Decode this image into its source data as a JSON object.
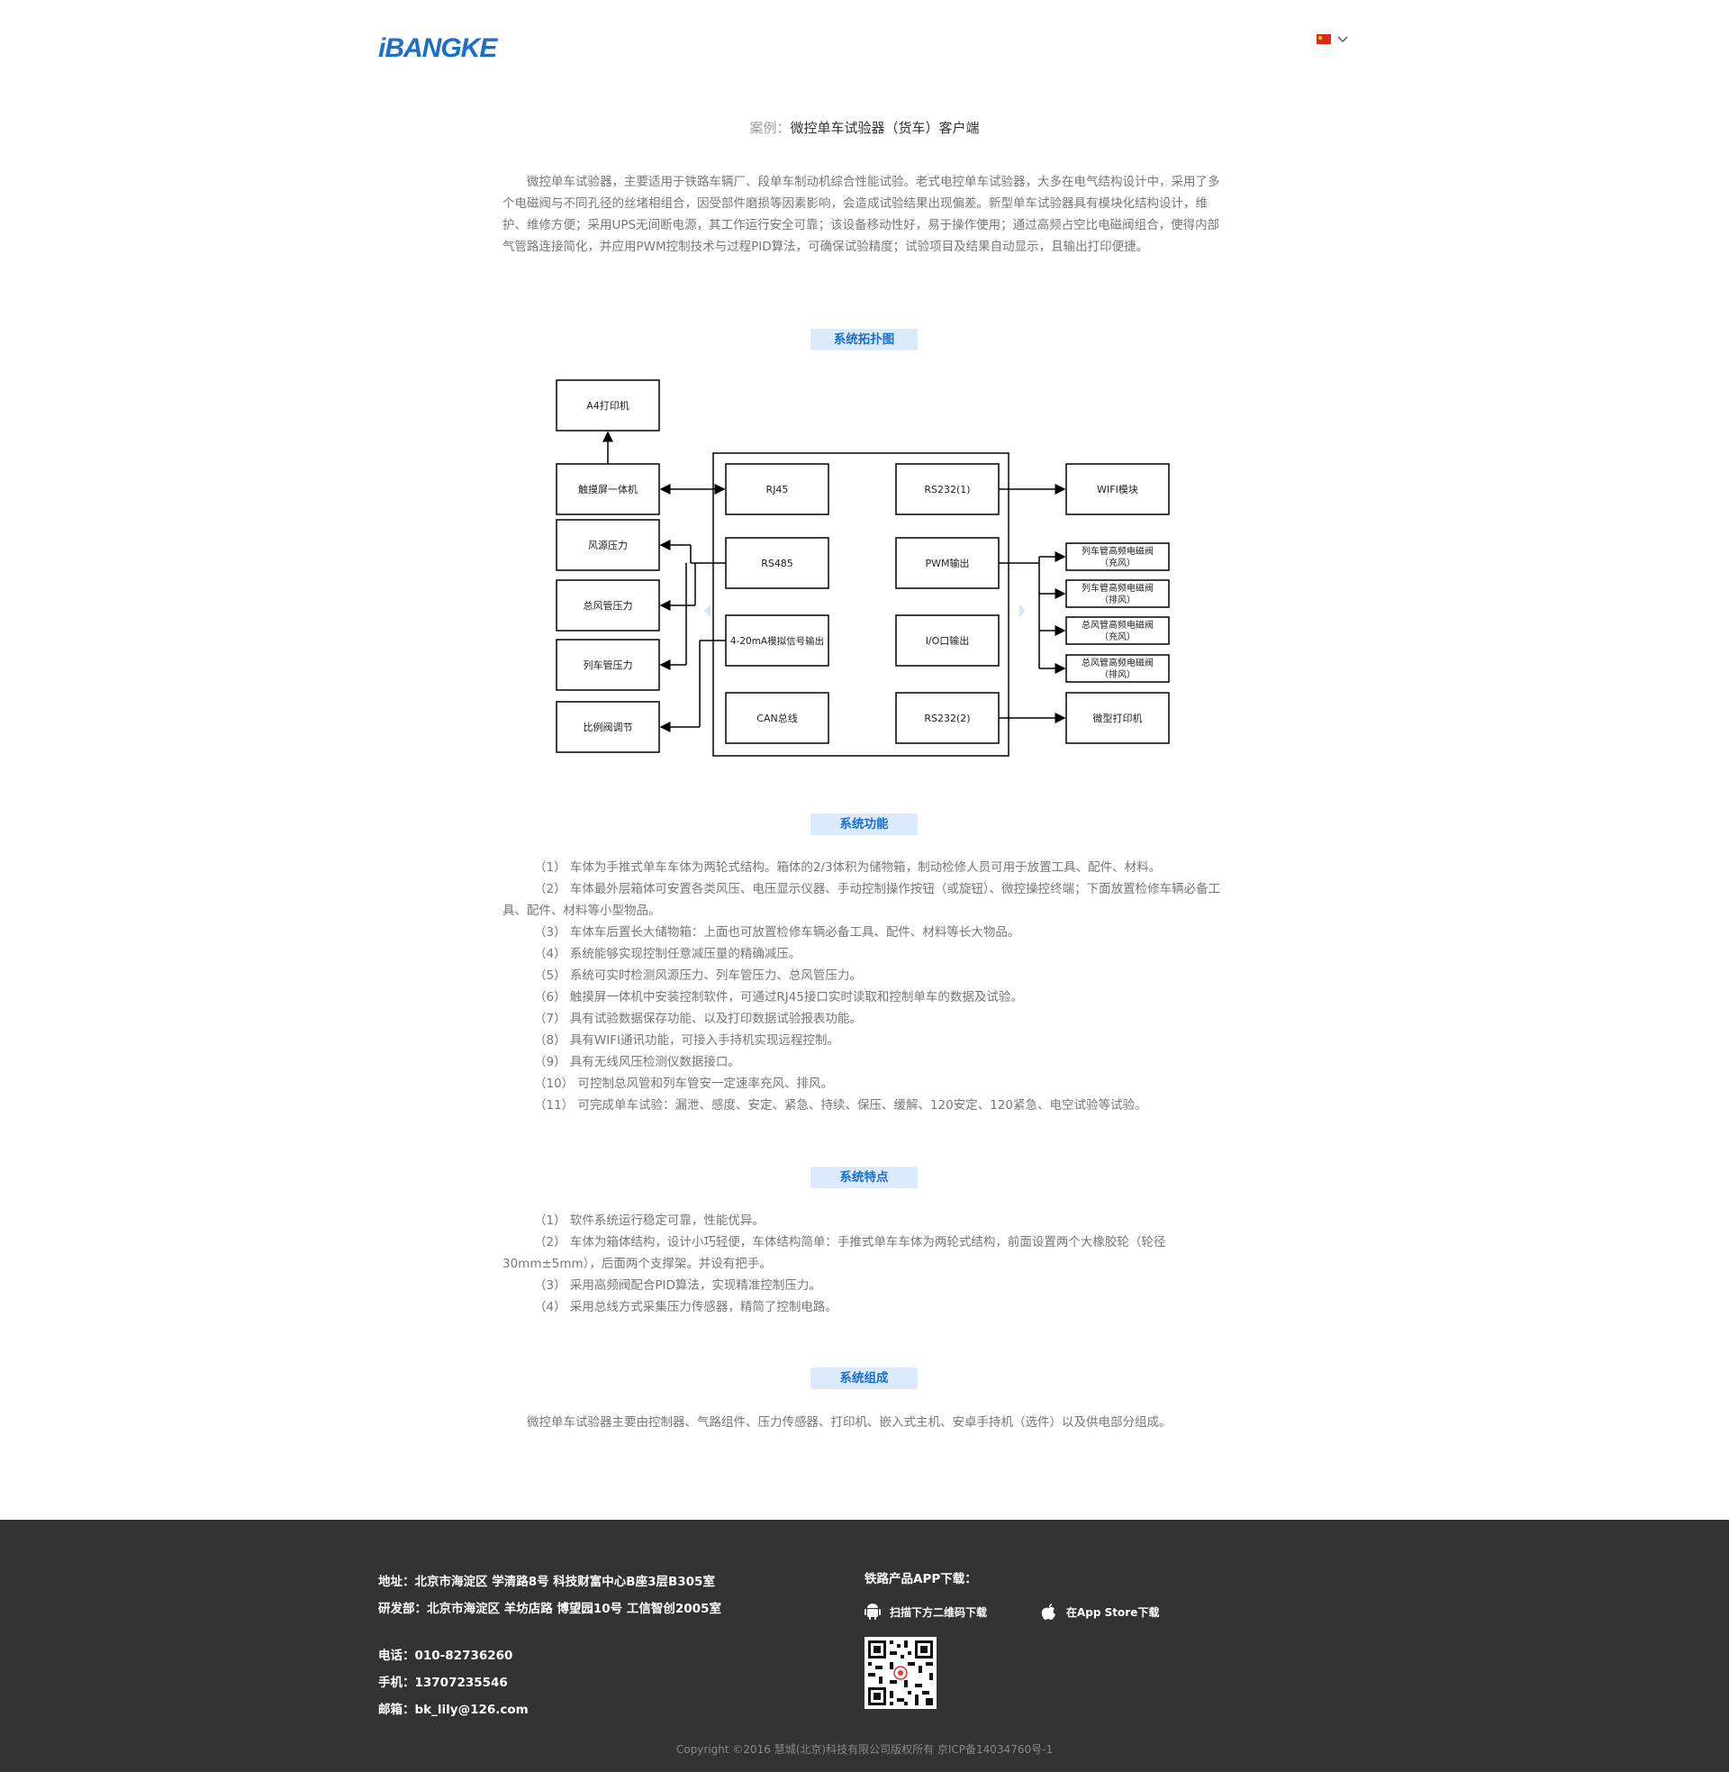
{
  "header": {
    "logo_text": "iBANGKE",
    "language_flag": "china-flag",
    "brand_color": "#1a6fc9"
  },
  "page": {
    "title_label": "案例：",
    "title": "微控单车试验器（货车）客户端",
    "intro": "微控单车试验器，主要适用于铁路车辆厂、段单车制动机综合性能试验。老式电控单车试验器，大多在电气结构设计中，采用了多个电磁阀与不同孔径的丝堵相组合，因受部件磨损等因素影响，会造成试验结果出现偏差。新型单车试验器具有模块化结构设计，维护、维修方便；采用UPS无间断电源，其工作运行安全可靠；该设备移动性好，易于操作使用；通过高频占空比电磁阀组合，使得内部气管路连接简化，并应用PWM控制技术与过程PID算法，可确保试验精度；试验项目及结果自动显示，且输出打印便捷。"
  },
  "topology": {
    "heading": "系统拓扑图",
    "boxes": {
      "printer_a4": "A4打印机",
      "touch": "触摸屏一体机",
      "air_source": "风源压力",
      "main_pipe": "总风管压力",
      "train_pipe": "列车管压力",
      "prop_valve": "比例阀调节",
      "rj45": "RJ45",
      "rs485": "RS485",
      "analog": "4-20mA模拟信号输出",
      "can": "CAN总线",
      "rs232_1": "RS232(1)",
      "pwm": "PWM输出",
      "io": "I/O口输出",
      "rs232_2": "RS232(2)",
      "wifi": "WIFI模块",
      "v1_a": "列车管高频电磁阀",
      "v1_b": "（充风）",
      "v2_a": "列车管高频电磁阀",
      "v2_b": "（排风）",
      "v3_a": "总风管高频电磁阀",
      "v3_b": "（充风）",
      "v4_a": "总风管高频电磁阀",
      "v4_b": "（排风）",
      "micro_printer": "微型打印机"
    }
  },
  "functions": {
    "heading": "系统功能",
    "items": [
      "（1） 车体为手推式单车车体为两轮式结构。箱体的2/3体积为储物箱，制动检修人员可用于放置工具、配件、材料。",
      "（2） 车体最外层箱体可安置各类风压、电压显示仪器、手动控制操作按钮（或旋钮）、微控操控终端；下面放置检修车辆必备工具、配件、材料等小型物品。",
      "（3） 车体车后置长大储物箱：上面也可放置检修车辆必备工具、配件、材料等长大物品。",
      "（4） 系统能够实现控制任意减压量的精确减压。",
      "（5） 系统可实时检测风源压力、列车管压力、总风管压力。",
      "（6） 触摸屏一体机中安装控制软件，可通过RJ45接口实时读取和控制单车的数据及试验。",
      "（7） 具有试验数据保存功能、以及打印数据试验报表功能。",
      "（8） 具有WIFI通讯功能，可接入手持机实现远程控制。",
      "（9） 具有无线风压检测仪数据接口。",
      "（10）       可控制总风管和列车管安一定速率充风、排风。",
      "（11）       可完成单车试验：漏泄、感度、安定、紧急、持续、保压、缓解、120安定、120紧急、电空试验等试验。"
    ]
  },
  "features": {
    "heading": "系统特点",
    "items": [
      "（1） 软件系统运行稳定可靠，性能优异。",
      "（2） 车体为箱体结构，设计小巧轻便，车体结构简单：手推式单车车体为两轮式结构，前面设置两个大橡胶轮（轮径30mm±5mm），后面两个支撑架。并设有把手。",
      "（3） 采用高频阀配合PID算法，实现精准控制压力。",
      "（4） 采用总线方式采集压力传感器，精简了控制电路。"
    ]
  },
  "composition": {
    "heading": "系统组成",
    "text": "微控单车试验器主要由控制器、气路组件、压力传感器、打印机、嵌入式主机、安卓手持机（选件）以及供电部分组成。"
  },
  "footer": {
    "address": "地址：北京市海淀区 学清路8号 科技财富中心B座3层B305室",
    "rd": "研发部：北京市海淀区 羊坊店路 博望园10号 工信智创2005室",
    "phone": "电话：010-82736260",
    "mobile": "手机：13707235546",
    "email": "邮箱：bk_lily@126.com",
    "app_title": "铁路产品APP下载：",
    "android_label": "扫描下方二维码下载",
    "ios_label": "在App Store下载",
    "copyright": "Copyright ©2016 慧城(北京)科技有限公司版权所有   京ICP备14034760号-1"
  }
}
